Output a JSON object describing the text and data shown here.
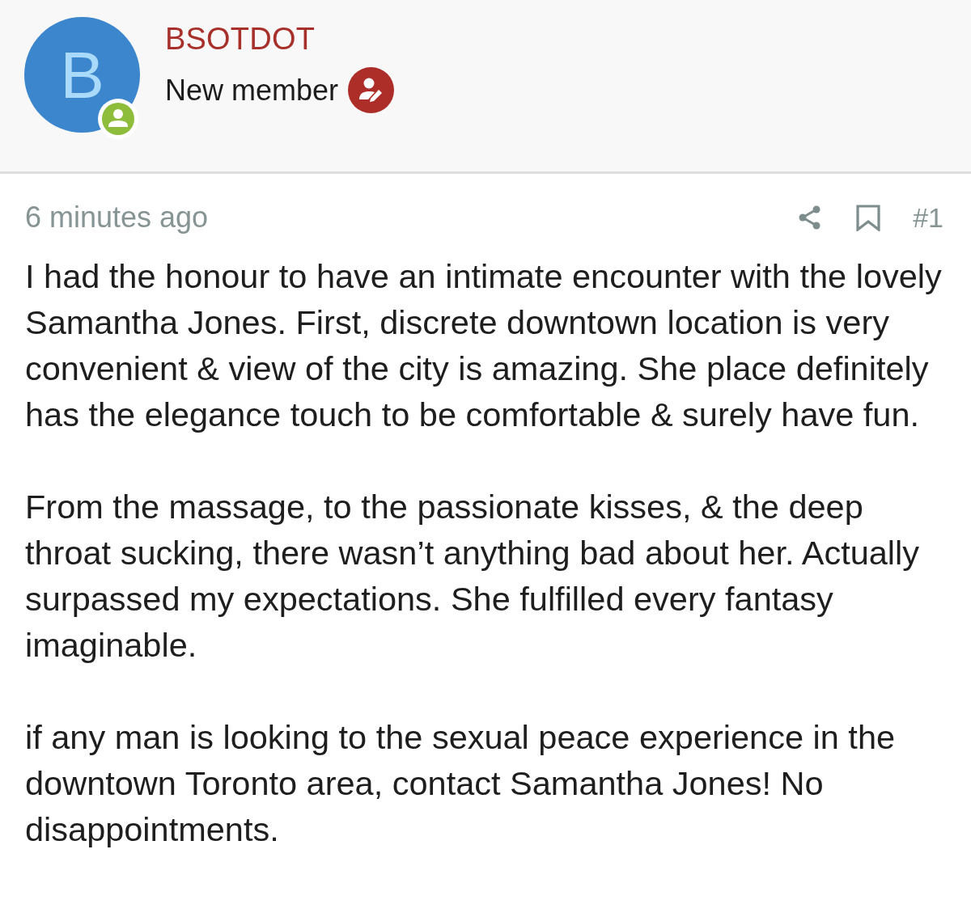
{
  "author": {
    "avatar_letter": "B",
    "name": "BSOTDOT",
    "role": "New member"
  },
  "post": {
    "time": "6 minutes ago",
    "number": "#1",
    "paragraphs": [
      "I had the honour to have an intimate encounter with the lovely Samantha Jones. First, discrete downtown location is very convenient & view of the city is amazing. She place definitely has the elegance touch to be comfortable & surely have fun.",
      "From the massage, to the passionate kisses, & the deep throat sucking, there wasn’t anything bad about her. Actually surpassed my expectations. She fulfilled every fantasy imaginable.",
      "if any man is looking to the sexual peace experience in the downtown Toronto area, contact Samantha Jones! No disappointments."
    ]
  }
}
